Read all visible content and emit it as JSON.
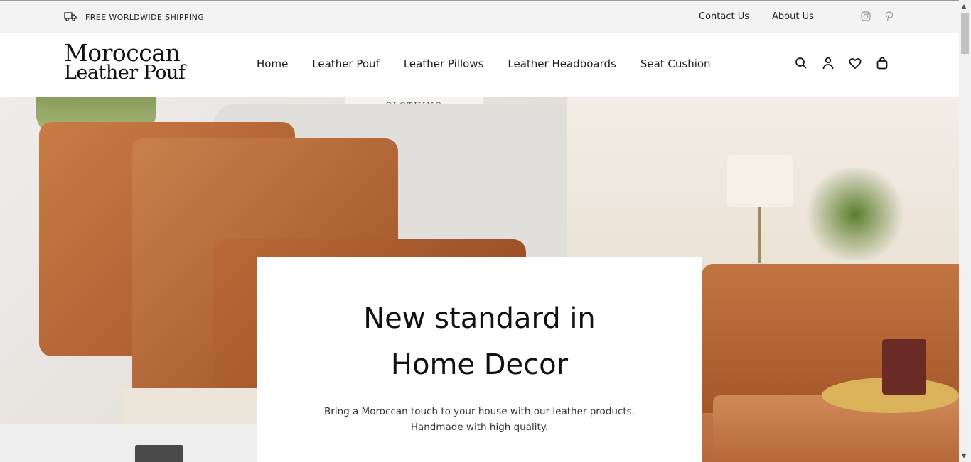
{
  "topbar": {
    "shipping": "FREE WORLDWIDE SHIPPING",
    "links": [
      "Contact Us",
      "About Us"
    ],
    "social": [
      "instagram-icon",
      "pinterest-icon"
    ]
  },
  "header": {
    "logo_line1": "Moroccan",
    "logo_line2": "Leather Pouf",
    "nav": [
      "Home",
      "Leather Pouf",
      "Leather Pillows",
      "Leather Headboards",
      "Seat Cushion"
    ],
    "icons": [
      "search-icon",
      "account-icon",
      "wishlist-icon",
      "cart-icon"
    ]
  },
  "hero": {
    "title_line1": "New standard in",
    "title_line2": "Home Decor",
    "subtitle_line1": "Bring a Moroccan touch to your house with our leather products.",
    "subtitle_line2": "Handmade with high quality.",
    "book_label": "CLOTHING"
  },
  "colors": {
    "topbar_bg": "#f3f3f3",
    "leather": "#b5632f",
    "text": "#111111"
  }
}
